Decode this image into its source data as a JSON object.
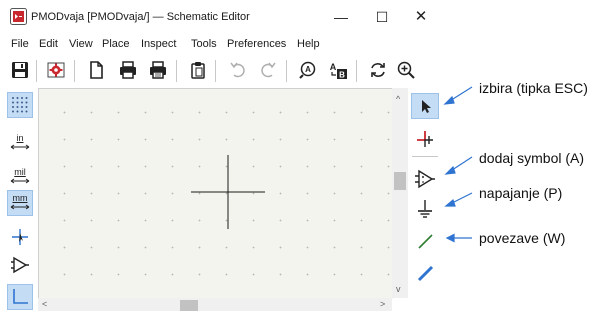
{
  "window": {
    "title": "PMODvaja [PMODvaja/] — Schematic Editor",
    "min_glyph": "—",
    "max_glyph": "☐",
    "close_glyph": "✕"
  },
  "menu": [
    "File",
    "Edit",
    "View",
    "Place",
    "Inspect",
    "Tools",
    "Preferences",
    "Help"
  ],
  "toolbar": {
    "icons": [
      "save-icon",
      "schematic-setup-icon",
      "page-settings-icon",
      "print-icon",
      "plot-icon",
      "paste-icon",
      "undo-icon",
      "redo-icon",
      "find-icon",
      "find-replace-icon",
      "refresh-icon",
      "zoom-in-icon"
    ]
  },
  "left_toolbar": {
    "grid_selected": true,
    "units": {
      "in": "in",
      "mil": "mil",
      "mm": "mm"
    },
    "selected_unit": "mm"
  },
  "right_toolbar": {
    "selected": "select-tool",
    "tools": [
      "select-tool",
      "highlight-net-tool",
      "add-symbol-tool",
      "add-power-tool",
      "add-wire-tool",
      "add-bus-tool"
    ]
  },
  "annotations": {
    "select": "izbira (tipka ESC)",
    "symbol": "dodaj symbol (A)",
    "power": "napajanje (P)",
    "wire": "povezave (W)"
  },
  "colors": {
    "accent_blue": "#2f74d0",
    "selected_bg": "#c5dcf5",
    "canvas_bg": "#f4f4ee",
    "icon_red": "#c8282e"
  }
}
